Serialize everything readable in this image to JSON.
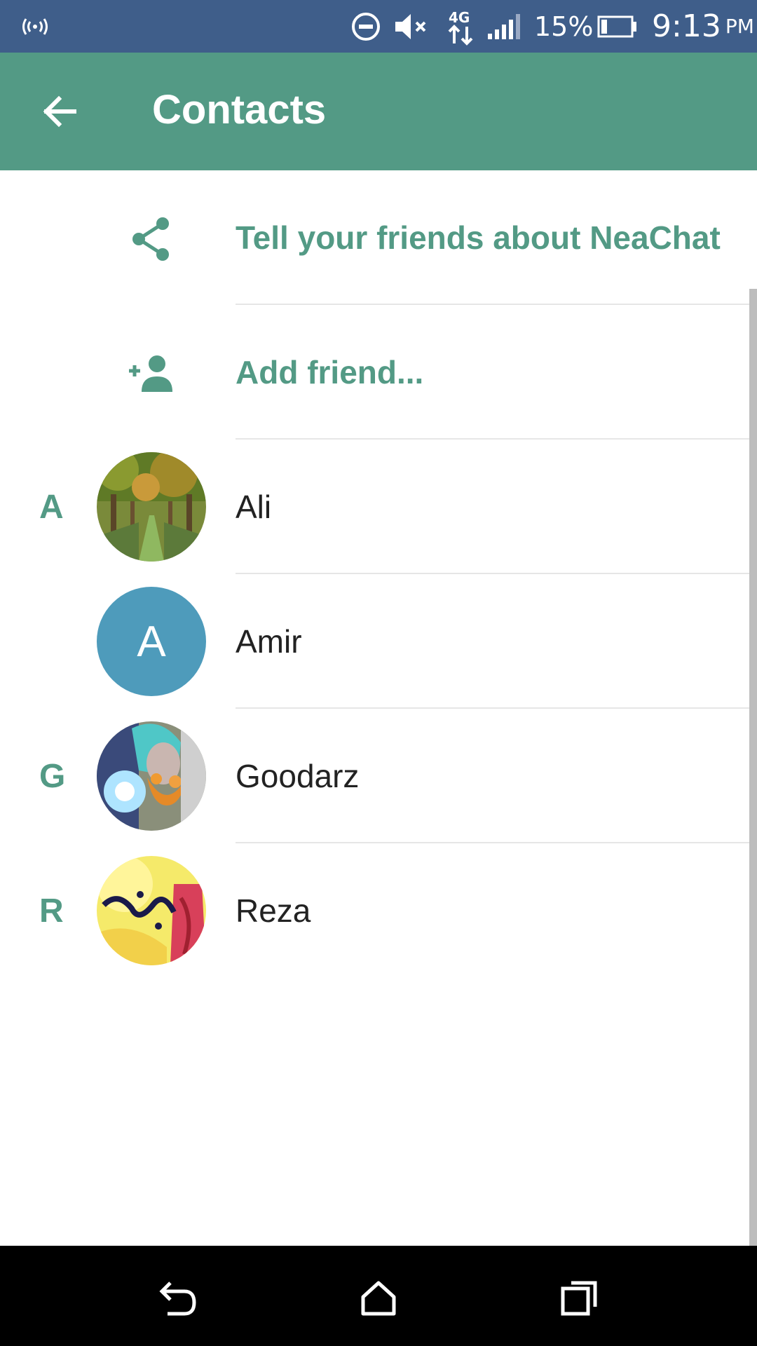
{
  "status_bar": {
    "battery_percent": "15%",
    "time": "9:13",
    "ampm": "PM",
    "network_type": "4G",
    "icons": [
      "hotspot-icon",
      "do-not-disturb-icon",
      "mute-icon",
      "network-4g-icon",
      "signal-icon",
      "battery-icon"
    ]
  },
  "app_bar": {
    "title": "Contacts",
    "back_icon": "arrow-left-icon"
  },
  "actions": [
    {
      "label": "Tell your friends about NeaChat",
      "icon": "share-icon"
    },
    {
      "label": "Add friend...",
      "icon": "add-person-icon"
    }
  ],
  "contacts": [
    {
      "section": "A",
      "name": "Ali",
      "avatar": "photo"
    },
    {
      "section": "",
      "name": "Amir",
      "avatar": "letter",
      "avatar_letter": "A"
    },
    {
      "section": "G",
      "name": "Goodarz",
      "avatar": "photo"
    },
    {
      "section": "R",
      "name": "Reza",
      "avatar": "photo"
    }
  ],
  "colors": {
    "status_bar": "#3f5e8a",
    "primary": "#539a85",
    "avatar_blue": "#4e9bbb",
    "text": "#222222"
  },
  "nav_bar": {
    "icons": [
      "back-nav-icon",
      "home-icon",
      "recents-icon"
    ]
  }
}
